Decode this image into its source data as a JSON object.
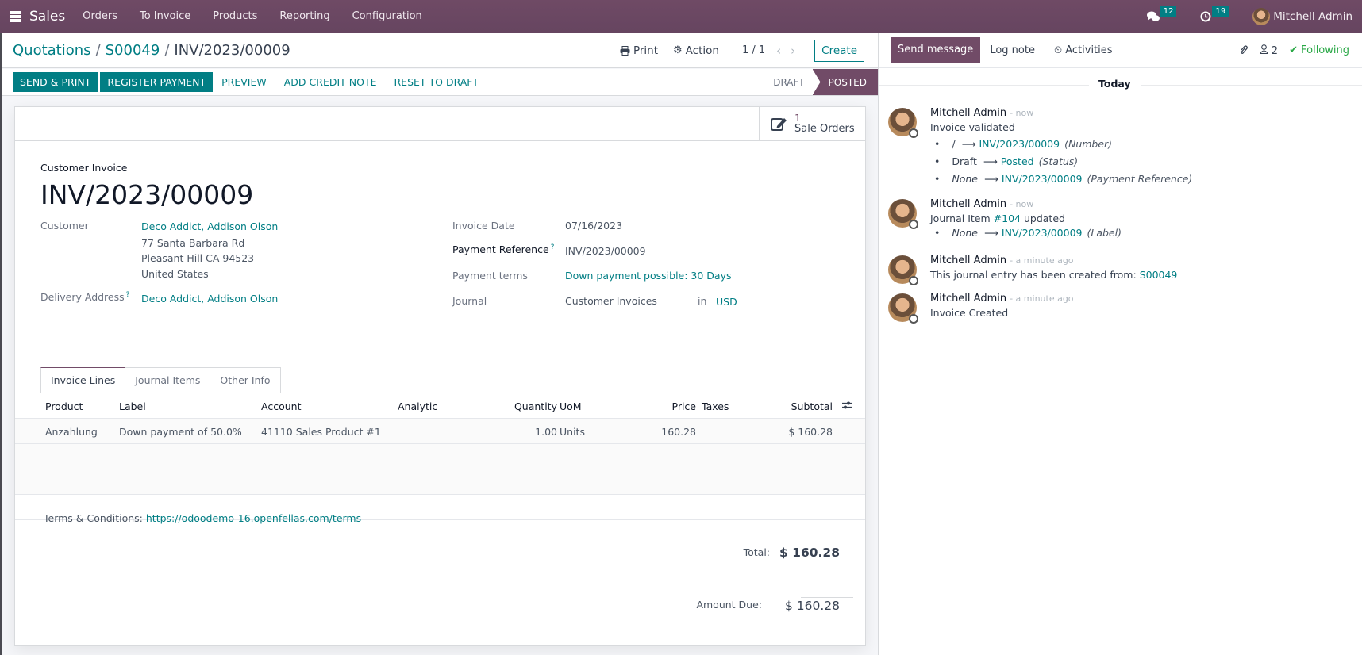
{
  "navbar": {
    "app_name": "Sales",
    "menu": [
      "Orders",
      "To Invoice",
      "Products",
      "Reporting",
      "Configuration"
    ],
    "messages_count": "12",
    "activities_count": "19",
    "user_name": "Mitchell Admin",
    "icons": {
      "apps": "apps-grid-icon",
      "messages": "chat-bubbles-icon",
      "activities": "clock-icon"
    }
  },
  "control_panel": {
    "breadcrumb": [
      {
        "label": "Quotations"
      },
      {
        "label": "S00049"
      },
      {
        "label": "INV/2023/00009"
      }
    ],
    "print_label": "Print",
    "action_label": "Action",
    "pager": "1 / 1",
    "create_label": "Create"
  },
  "status_bar": {
    "buttons_primary": [
      "SEND & PRINT",
      "REGISTER PAYMENT"
    ],
    "buttons_link": [
      "PREVIEW",
      "ADD CREDIT NOTE",
      "RESET TO DRAFT"
    ],
    "stages": [
      {
        "label": "DRAFT",
        "active": false
      },
      {
        "label": "POSTED",
        "active": true
      }
    ]
  },
  "smart_button": {
    "value": "1",
    "label": "Sale Orders"
  },
  "invoice": {
    "type": "Customer Invoice",
    "number": "INV/2023/00009",
    "customer_label": "Customer",
    "customer_name": "Deco Addict, Addison Olson",
    "address_line1": "77 Santa Barbara Rd",
    "address_line2": "Pleasant Hill CA 94523",
    "address_line3": "United States",
    "delivery_label": "Delivery Address",
    "delivery_value": "Deco Addict, Addison Olson",
    "invoice_date_label": "Invoice Date",
    "invoice_date": "07/16/2023",
    "payment_ref_label": "Payment Reference",
    "payment_ref": "INV/2023/00009",
    "payment_terms_label": "Payment terms",
    "payment_terms": "Down payment possible: 30 Days",
    "journal_label": "Journal",
    "journal": "Customer Invoices",
    "in_label": "in",
    "currency": "USD",
    "tooltip_mark": "?"
  },
  "tabs": [
    {
      "label": "Invoice Lines",
      "active": true
    },
    {
      "label": "Journal Items",
      "active": false
    },
    {
      "label": "Other Info",
      "active": false
    }
  ],
  "lines": {
    "columns": [
      "Product",
      "Label",
      "Account",
      "Analytic",
      "Quantity",
      "UoM",
      "Price",
      "Taxes",
      "Subtotal"
    ],
    "rows": [
      {
        "product": "Anzahlung",
        "label": "Down payment of 50.0%",
        "account": "41110 Sales Product #1",
        "analytic": "",
        "quantity": "1.00",
        "uom": "Units",
        "price": "160.28",
        "taxes": "",
        "subtotal": "$ 160.28"
      }
    ]
  },
  "footer": {
    "terms_label": "Terms & Conditions:",
    "terms_link": "https://odoodemo-16.openfellas.com/terms",
    "total_label": "Total:",
    "total_value": "$ 160.28",
    "amount_due_label": "Amount Due:",
    "amount_due_value": "$ 160.28"
  },
  "chatter": {
    "send_message": "Send message",
    "log_note": "Log note",
    "activities": "Activities",
    "followers_count": "2",
    "following_label": "Following",
    "date_separator": "Today",
    "messages": [
      {
        "author": "Mitchell Admin",
        "date": "- now",
        "text": "Invoice validated",
        "tracking": [
          {
            "old": "/",
            "old_italic": false,
            "new": "INV/2023/00009",
            "field": "(Number)"
          },
          {
            "old": "Draft",
            "old_italic": false,
            "new": "Posted",
            "field": "(Status)"
          },
          {
            "old": "None",
            "old_italic": true,
            "new": "INV/2023/00009",
            "field": "(Payment Reference)"
          }
        ]
      },
      {
        "author": "Mitchell Admin",
        "date": "- now",
        "text_prefix": "Journal Item",
        "text_link": "#104",
        "text_suffix": "updated",
        "tracking": [
          {
            "old": "None",
            "old_italic": true,
            "new": "INV/2023/00009",
            "field": "(Label)"
          }
        ]
      },
      {
        "author": "Mitchell Admin",
        "date": "- a minute ago",
        "text_prefix": "This journal entry has been created from:",
        "text_link": "S00049"
      },
      {
        "author": "Mitchell Admin",
        "date": "- a minute ago",
        "text": "Invoice Created"
      }
    ]
  }
}
